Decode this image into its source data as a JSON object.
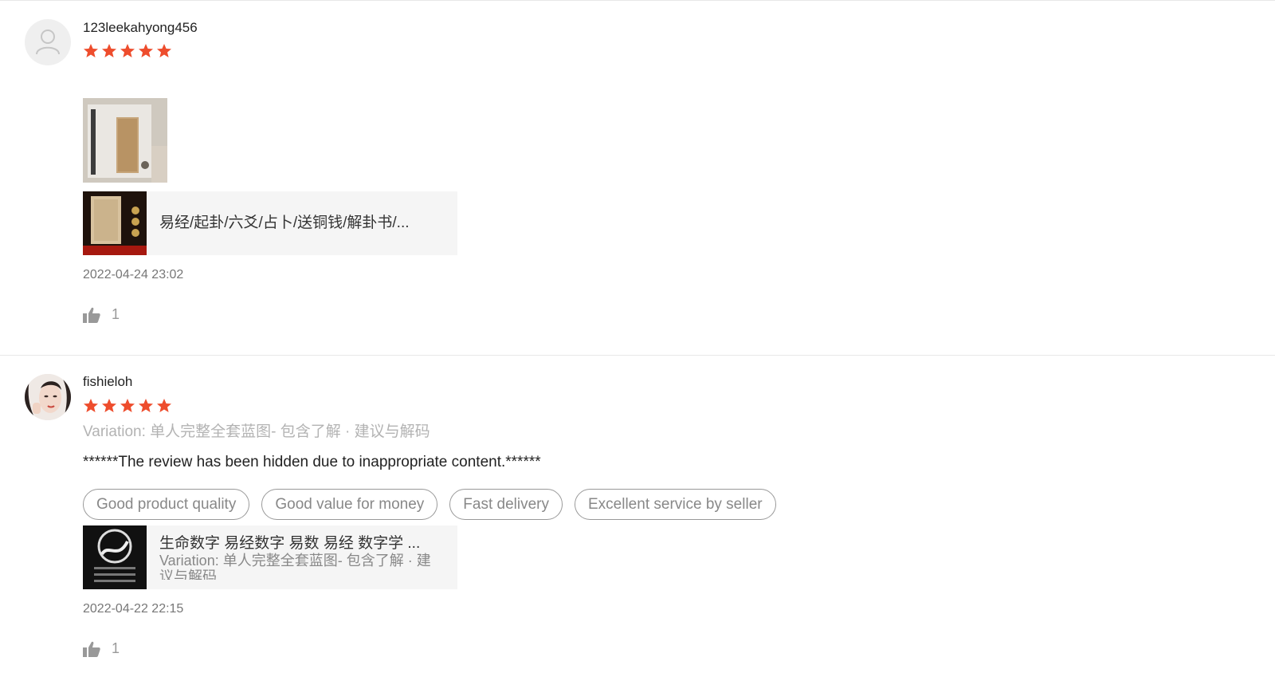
{
  "colors": {
    "star": "#ee4d2d",
    "divider": "#e8e8e8",
    "card_bg": "#f5f5f5"
  },
  "reviews": [
    {
      "username": "123leekahyong456",
      "rating": 5,
      "product": {
        "name": "易经/起卦/六爻/占卜/送铜钱/解卦书/..."
      },
      "date": "2022-04-24 23:02",
      "likes": "1"
    },
    {
      "username": "fishieloh",
      "rating": 5,
      "variation": "Variation: 单人完整全套蓝图- 包含了解 · 建议与解码",
      "text": "******The review has been hidden due to inappropriate content.******",
      "tags": [
        "Good product quality",
        "Good value for money",
        "Fast delivery",
        "Excellent service by seller"
      ],
      "product": {
        "name": "生命数字 易经数字 易数 易经 数字学 ...",
        "variation": "Variation: 单人完整全套蓝图- 包含了解 · 建议与解码"
      },
      "date": "2022-04-22 22:15",
      "likes": "1"
    }
  ]
}
